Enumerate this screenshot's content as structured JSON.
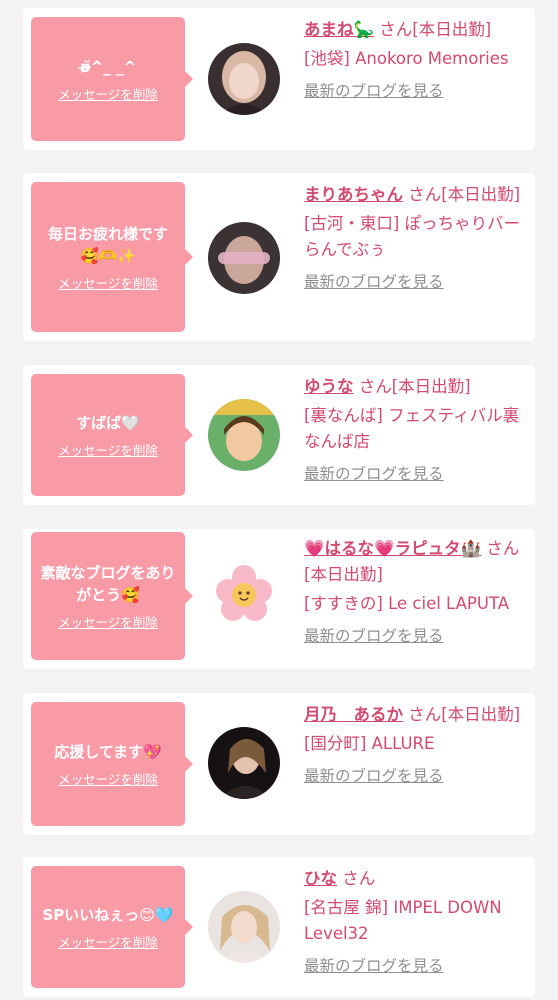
{
  "items": [
    {
      "message": "ʚ̴̶̷̆^_ _^",
      "delete_label": "メッセージを削除",
      "name": "あまね🦕",
      "suffix": "さん[本日出勤]",
      "shop": "[池袋] Anokoro Memories",
      "blog_label": "最新のブログを見る",
      "avatar_icon": "user-photo-icon"
    },
    {
      "message": "毎日お疲れ様です🥰🫶✨",
      "delete_label": "メッセージを削除",
      "name": "まりあちゃん",
      "suffix": "さん[本日出勤]",
      "shop": "[古河・東口] ぽっちゃりバー らんでぶぅ",
      "blog_label": "最新のブログを見る",
      "avatar_icon": "user-photo-icon"
    },
    {
      "message": "すばば🤍",
      "delete_label": "メッセージを削除",
      "name": "ゆうな",
      "suffix": "さん[本日出勤]",
      "shop": "[裏なんば] フェスティバル裏なんば店",
      "blog_label": "最新のブログを見る",
      "avatar_icon": "user-photo-icon"
    },
    {
      "message": "素敵なブログをありがとう🥰",
      "delete_label": "メッセージを削除",
      "name": "💗はるな💗ラピュタ🏰",
      "suffix": "さん[本日出勤]",
      "shop": "[すすきの] Le ciel LAPUTA",
      "blog_label": "最新のブログを見る",
      "avatar_icon": "flower-mascot-icon"
    },
    {
      "message": "応援してます💖",
      "delete_label": "メッセージを削除",
      "name": "月乃　あるか",
      "suffix": "さん[本日出勤]",
      "shop": "[国分町] ALLURE",
      "blog_label": "最新のブログを見る",
      "avatar_icon": "user-photo-icon"
    },
    {
      "message": "SPいいねぇっ😊🩵",
      "delete_label": "メッセージを削除",
      "name": "ひな",
      "suffix": "さん",
      "shop": "[名古屋 錦] IMPEL DOWN Level32",
      "blog_label": "最新のブログを見る",
      "avatar_icon": "user-photo-icon"
    }
  ],
  "colors": {
    "accent": "#d14a70",
    "bubble": "#f99ba7",
    "link_gray": "#8f8f8f"
  }
}
